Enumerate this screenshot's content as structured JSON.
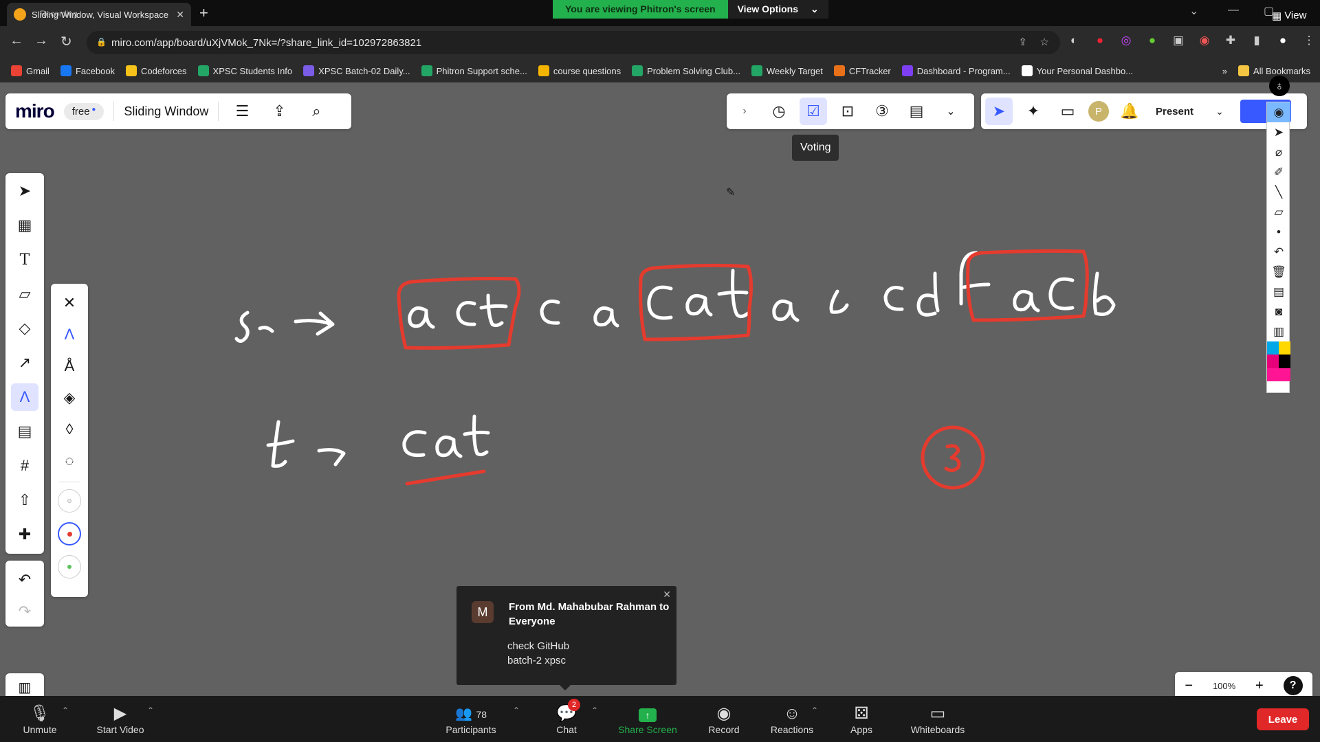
{
  "browser": {
    "tab_title": "Sliding Window, Visual Workspace f",
    "recording_label": "Recording",
    "share_banner": "You are viewing Phitron's screen",
    "view_options": "View Options",
    "view_label": "View",
    "url": "miro.com/app/board/uXjVMok_7Nk=/?share_link_id=102972863821"
  },
  "bookmarks": [
    {
      "label": "Gmail",
      "icon": "gmail-icon",
      "color": "#ea4335"
    },
    {
      "label": "Facebook",
      "icon": "facebook-icon",
      "color": "#1877f2"
    },
    {
      "label": "Codeforces",
      "icon": "codeforces-icon",
      "color": "#f7c31b"
    },
    {
      "label": "XPSC Students Info",
      "icon": "sheets-icon",
      "color": "#23a566"
    },
    {
      "label": "XPSC Batch-02 Daily...",
      "icon": "list-icon",
      "color": "#7b5ce6"
    },
    {
      "label": "Phitron Support sche...",
      "icon": "sheets-icon",
      "color": "#23a566"
    },
    {
      "label": "course questions",
      "icon": "chart-icon",
      "color": "#f4b400"
    },
    {
      "label": "Problem Solving Club...",
      "icon": "sheets-icon",
      "color": "#23a566"
    },
    {
      "label": "Weekly Target",
      "icon": "sheets-icon",
      "color": "#23a566"
    },
    {
      "label": "CFTracker",
      "icon": "chart-icon",
      "color": "#e8711a"
    },
    {
      "label": "Dashboard - Program...",
      "icon": "dashboard-icon",
      "color": "#7e3ff2"
    },
    {
      "label": "Your Personal Dashbo...",
      "icon": "notion-icon",
      "color": "#ffffff"
    }
  ],
  "bookmarks_more": "»",
  "all_bookmarks": "All Bookmarks",
  "miro": {
    "logo": "miro",
    "plan": "free",
    "board_name": "Sliding Window",
    "present": "Present",
    "tooltip": "Voting",
    "zoom": "100%",
    "avatar_letter": "P"
  },
  "zoom_bar": {
    "unmute": "Unmute",
    "start_video": "Start Video",
    "participants_count": "78",
    "participants": "Participants",
    "chat": "Chat",
    "chat_badge": "2",
    "share_screen": "Share Screen",
    "record": "Record",
    "reactions": "Reactions",
    "apps": "Apps",
    "whiteboards": "Whiteboards",
    "leave": "Leave"
  },
  "chat_popup": {
    "avatar": "M",
    "from": "From Md. Mahabubar Rahman to Everyone",
    "line1": "check GitHub",
    "line2": "batch-2 xpsc"
  },
  "colors": {
    "accent": "#3859ff",
    "ink_red": "#e53b2e",
    "ink_white": "#ffffff",
    "zoom_green": "#23b14d",
    "leave_red": "#e02828"
  }
}
